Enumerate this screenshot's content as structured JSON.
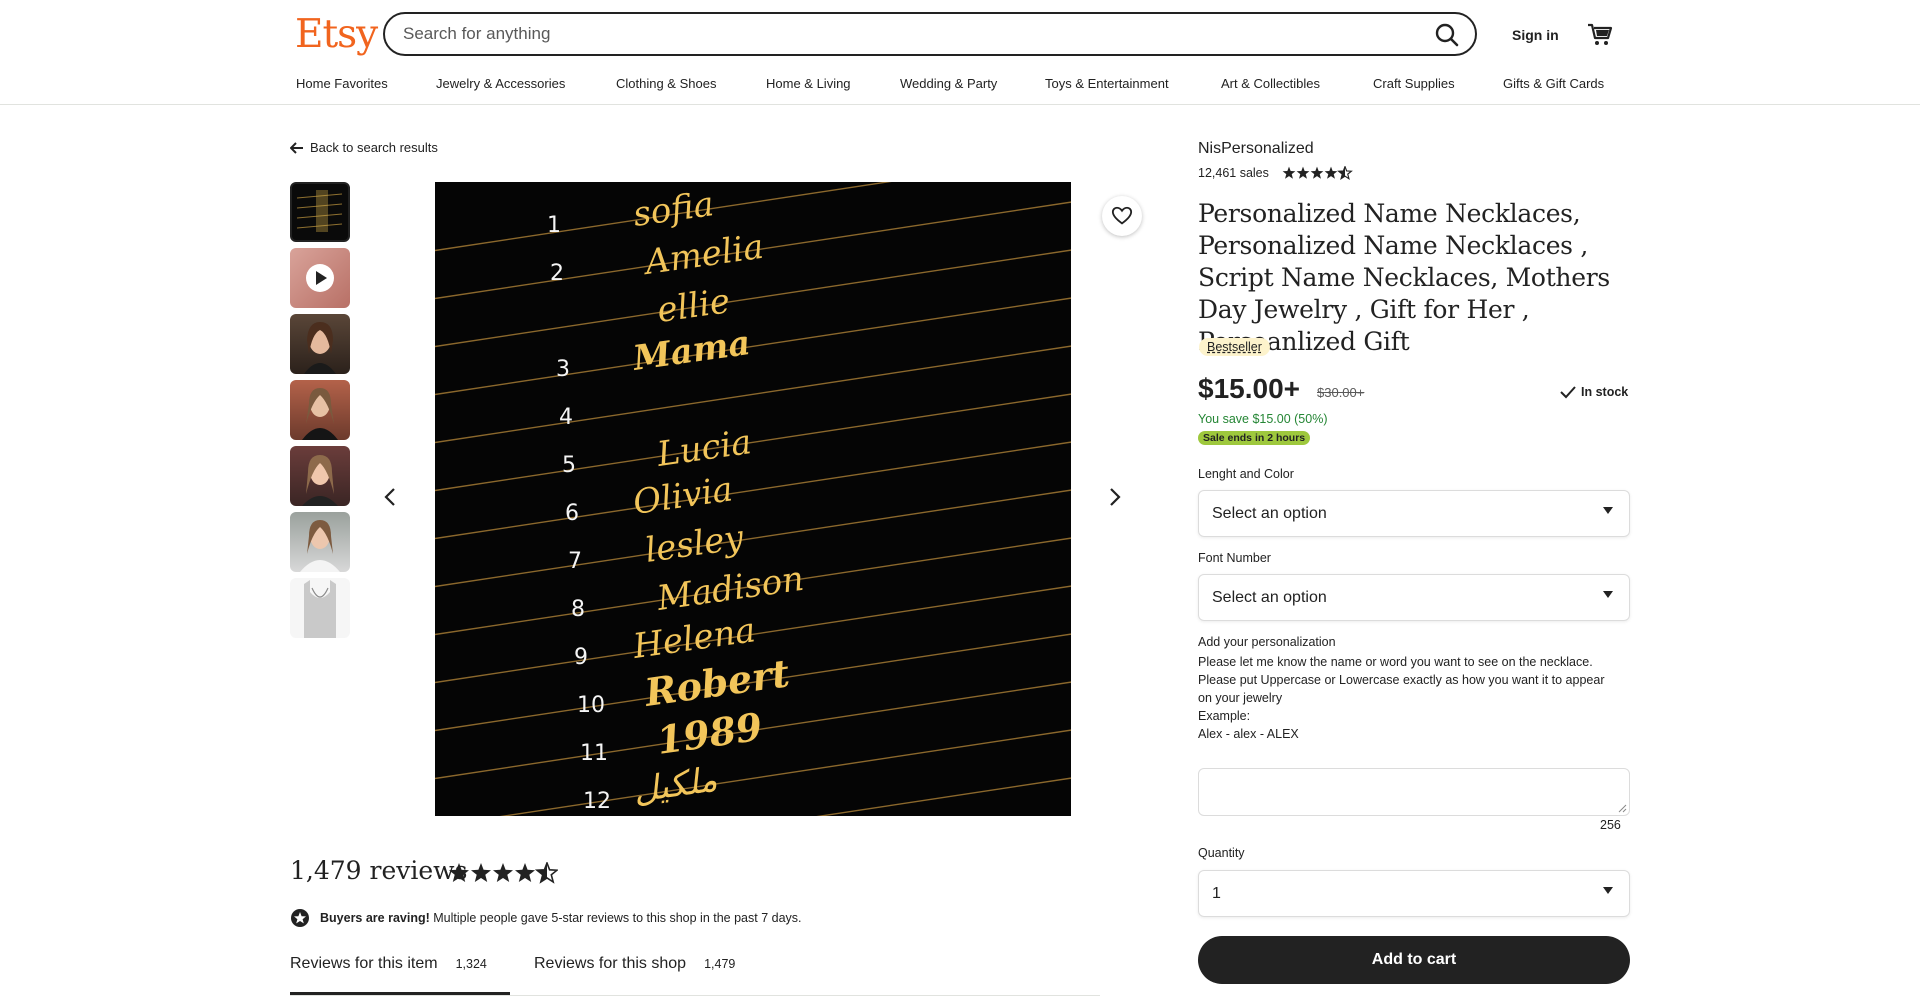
{
  "header": {
    "logo": "Etsy",
    "search_placeholder": "Search for anything",
    "signin": "Sign in",
    "brand_color": "#f1641e"
  },
  "nav": [
    "Home Favorites",
    "Jewelry & Accessories",
    "Clothing & Shoes",
    "Home & Living",
    "Wedding & Party",
    "Toys & Entertainment",
    "Art & Collectibles",
    "Craft Supplies",
    "Gifts & Gift Cards"
  ],
  "back": "Back to search results",
  "gallery": {
    "name_rows": [
      {
        "num": "1",
        "name": "sofia"
      },
      {
        "num": "2",
        "name": "Amelia"
      },
      {
        "num": "",
        "name": "ellie"
      },
      {
        "num": "3",
        "name": "Mama"
      },
      {
        "num": "4",
        "name": ""
      },
      {
        "num": "5",
        "name": "Lucia"
      },
      {
        "num": "6",
        "name": "Olivia"
      },
      {
        "num": "7",
        "name": "lesley"
      },
      {
        "num": "8",
        "name": "Madison"
      },
      {
        "num": "9",
        "name": "Helena"
      },
      {
        "num": "10",
        "name": "Robert"
      },
      {
        "num": "11",
        "name": "1989"
      },
      {
        "num": "12",
        "name": "ملكيل"
      }
    ]
  },
  "reviews": {
    "title": "1,479 reviews",
    "raving_bold": "Buyers are raving!",
    "raving_text": " Multiple people gave 5-star reviews to this shop in the past 7 days.",
    "tab_item": "Reviews for this item",
    "tab_item_count": "1,324",
    "tab_shop": "Reviews for this shop",
    "tab_shop_count": "1,479"
  },
  "listing": {
    "shop": "NisPersonalized",
    "sales": "12,461 sales",
    "title": "Personalized Name Necklaces, Personalized Name Necklaces , Script Name Necklaces, Mothers Day Jewelry , Gift for Her , Persoanlized Gift",
    "bestseller": "Bestseller",
    "price": "$15.00+",
    "orig_price": "$30.00+",
    "instock": "In stock",
    "save": "You save $15.00 (50%)",
    "sale_badge": "Sale ends in 2 hours",
    "length_label": "Lenght and Color",
    "length_value": "Select an option",
    "font_label": "Font Number",
    "font_value": "Select an option",
    "perso_label": "Add your personalization",
    "perso_lines": [
      "Please let me know the name or word you want to see on the necklace.",
      "Please put Uppercase or Lowercase exactly as how you want it to appear on your jewelry",
      "Example:",
      "Alex - alex - ALEX"
    ],
    "counter": "256",
    "qty_label": "Quantity",
    "qty_value": "1",
    "add_to_cart": "Add to cart",
    "sale_color": "#258635",
    "badge_color": "#9ec83d"
  }
}
